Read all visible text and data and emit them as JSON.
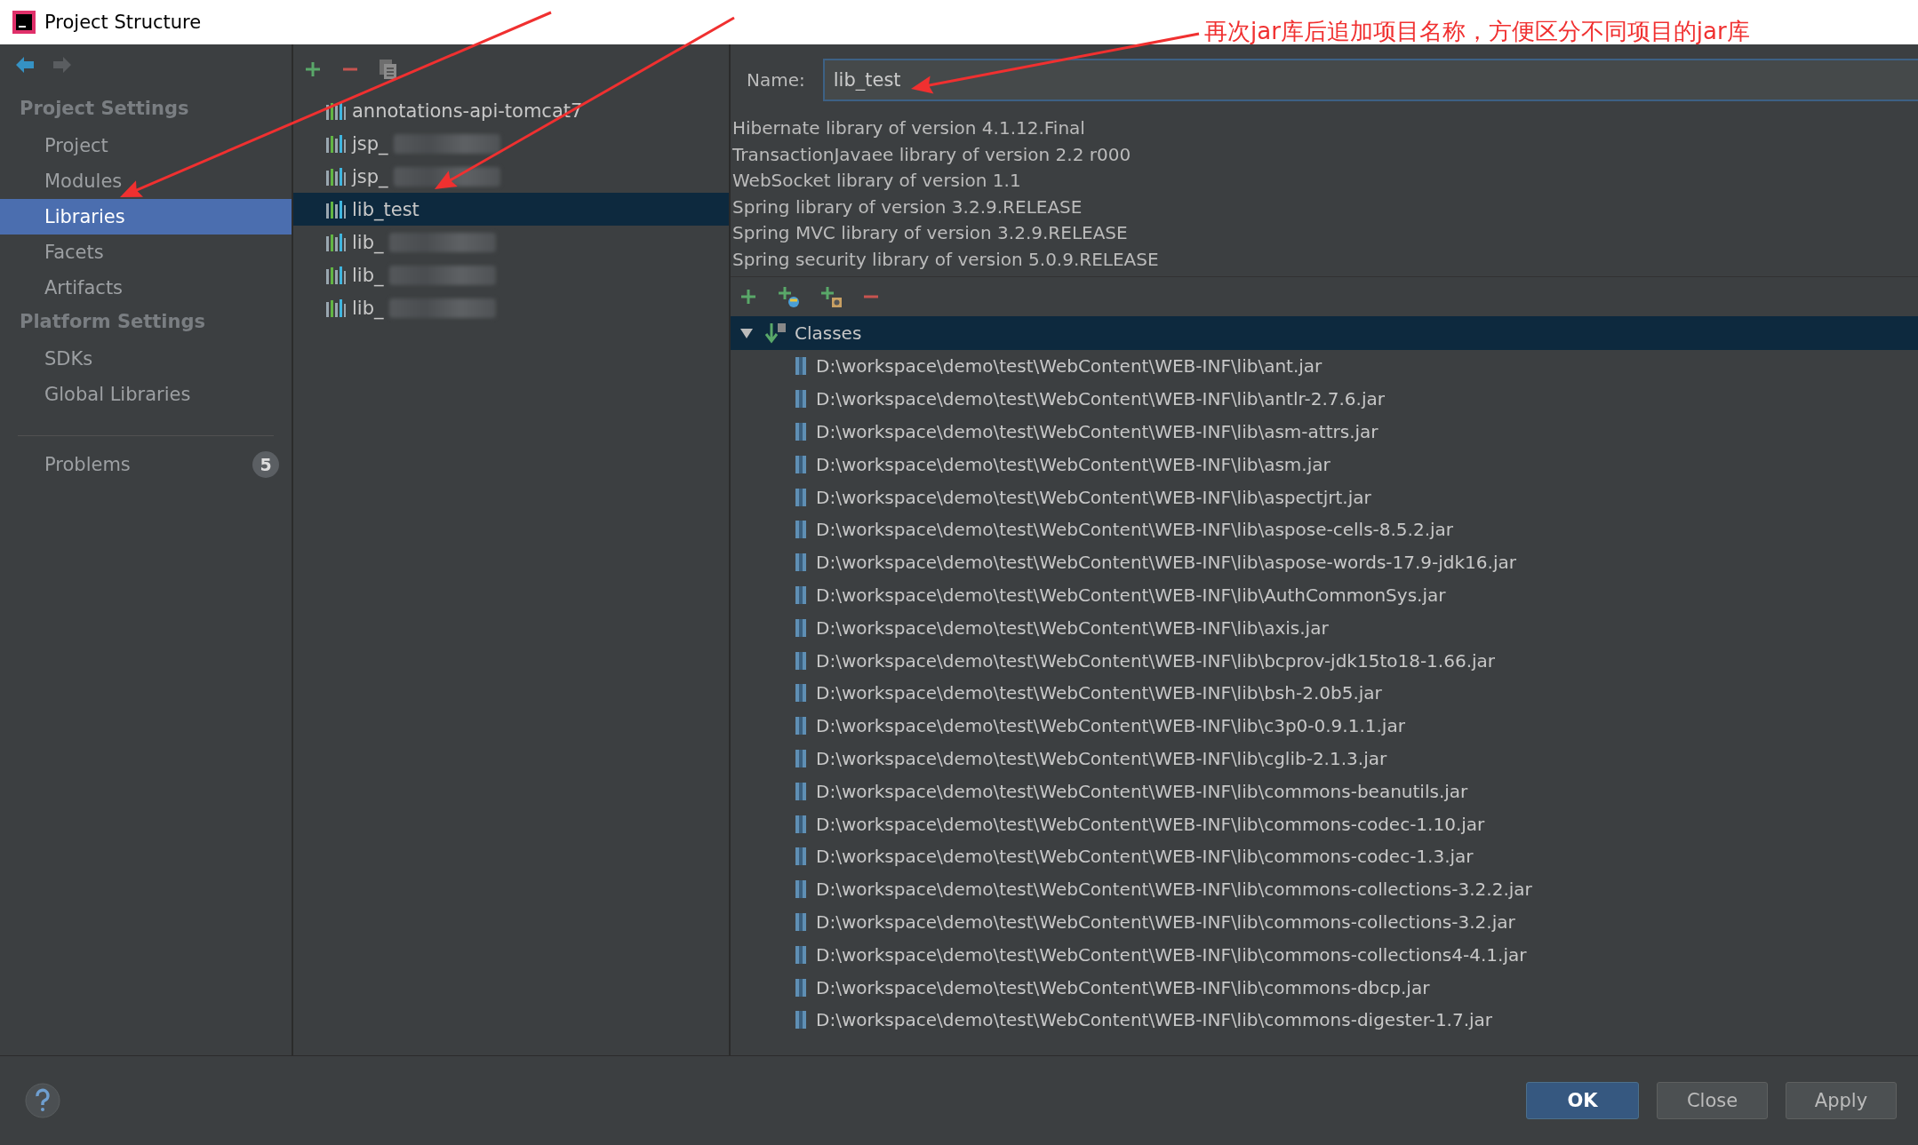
{
  "window": {
    "title": "Project Structure"
  },
  "sidebar": {
    "sections": [
      {
        "heading": "Project Settings",
        "items": [
          {
            "label": "Project",
            "selected": false
          },
          {
            "label": "Modules",
            "selected": false
          },
          {
            "label": "Libraries",
            "selected": true
          },
          {
            "label": "Facets",
            "selected": false
          },
          {
            "label": "Artifacts",
            "selected": false
          }
        ]
      },
      {
        "heading": "Platform Settings",
        "items": [
          {
            "label": "SDKs",
            "selected": false
          },
          {
            "label": "Global Libraries",
            "selected": false
          }
        ]
      }
    ],
    "problems": {
      "label": "Problems",
      "count": "5"
    }
  },
  "libraries": [
    {
      "name": "annotations-api-tomcat7",
      "selected": false,
      "blurred": false
    },
    {
      "name": "jsp_",
      "selected": false,
      "blurred": true
    },
    {
      "name": "jsp_",
      "selected": false,
      "blurred": true
    },
    {
      "name": "lib_test",
      "selected": true,
      "blurred": false
    },
    {
      "name": "lib_",
      "selected": false,
      "blurred": true
    },
    {
      "name": "lib_",
      "selected": false,
      "blurred": true
    },
    {
      "name": "lib_",
      "selected": false,
      "blurred": true
    }
  ],
  "detail": {
    "name_label": "Name:",
    "name_value": "lib_test",
    "descriptions": [
      "Hibernate library of version 4.1.12.Final",
      "TransactionJavaee library of version 2.2 r000",
      "WebSocket library of version 1.1",
      "Spring library of version 3.2.9.RELEASE",
      "Spring MVC library of version 3.2.9.RELEASE",
      "Spring security library of version 5.0.9.RELEASE"
    ],
    "classes": {
      "label": "Classes",
      "expanded": true,
      "jars": [
        "D:\\workspace\\demo\\test\\WebContent\\WEB-INF\\lib\\ant.jar",
        "D:\\workspace\\demo\\test\\WebContent\\WEB-INF\\lib\\antlr-2.7.6.jar",
        "D:\\workspace\\demo\\test\\WebContent\\WEB-INF\\lib\\asm-attrs.jar",
        "D:\\workspace\\demo\\test\\WebContent\\WEB-INF\\lib\\asm.jar",
        "D:\\workspace\\demo\\test\\WebContent\\WEB-INF\\lib\\aspectjrt.jar",
        "D:\\workspace\\demo\\test\\WebContent\\WEB-INF\\lib\\aspose-cells-8.5.2.jar",
        "D:\\workspace\\demo\\test\\WebContent\\WEB-INF\\lib\\aspose-words-17.9-jdk16.jar",
        "D:\\workspace\\demo\\test\\WebContent\\WEB-INF\\lib\\AuthCommonSys.jar",
        "D:\\workspace\\demo\\test\\WebContent\\WEB-INF\\lib\\axis.jar",
        "D:\\workspace\\demo\\test\\WebContent\\WEB-INF\\lib\\bcprov-jdk15to18-1.66.jar",
        "D:\\workspace\\demo\\test\\WebContent\\WEB-INF\\lib\\bsh-2.0b5.jar",
        "D:\\workspace\\demo\\test\\WebContent\\WEB-INF\\lib\\c3p0-0.9.1.1.jar",
        "D:\\workspace\\demo\\test\\WebContent\\WEB-INF\\lib\\cglib-2.1.3.jar",
        "D:\\workspace\\demo\\test\\WebContent\\WEB-INF\\lib\\commons-beanutils.jar",
        "D:\\workspace\\demo\\test\\WebContent\\WEB-INF\\lib\\commons-codec-1.10.jar",
        "D:\\workspace\\demo\\test\\WebContent\\WEB-INF\\lib\\commons-codec-1.3.jar",
        "D:\\workspace\\demo\\test\\WebContent\\WEB-INF\\lib\\commons-collections-3.2.2.jar",
        "D:\\workspace\\demo\\test\\WebContent\\WEB-INF\\lib\\commons-collections-3.2.jar",
        "D:\\workspace\\demo\\test\\WebContent\\WEB-INF\\lib\\commons-collections4-4.1.jar",
        "D:\\workspace\\demo\\test\\WebContent\\WEB-INF\\lib\\commons-dbcp.jar",
        "D:\\workspace\\demo\\test\\WebContent\\WEB-INF\\lib\\commons-digester-1.7.jar"
      ]
    }
  },
  "buttons": [
    {
      "label": "OK",
      "kind": "primary"
    },
    {
      "label": "Close",
      "kind": "normal"
    },
    {
      "label": "Apply",
      "kind": "normal"
    }
  ],
  "annotation": {
    "text": "再次jar库后追加项目名称，方便区分不同项目的jar库"
  }
}
